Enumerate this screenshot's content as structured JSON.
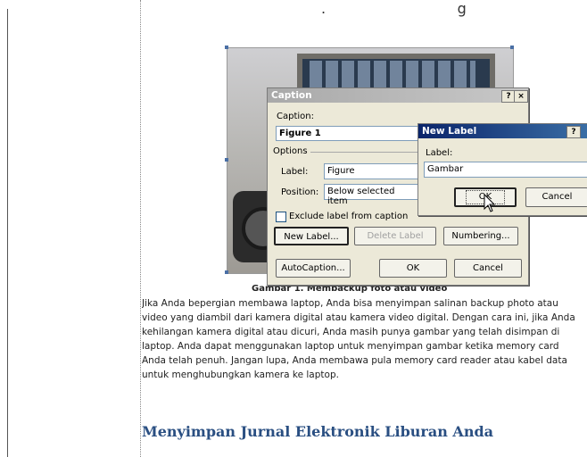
{
  "document": {
    "figure_caption": "Gambar 1. Membackup foto atau video",
    "paragraph_lines": [
      "Jika Anda bepergian membawa laptop, Anda bisa menyimpan salinan backup photo atau",
      "video yang diambil dari kamera digital atau kamera video digital. Dengan cara ini, jika Anda",
      "kehilangan kamera digital atau dicuri, Anda masih punya gambar yang telah disimpan di",
      "laptop. Anda dapat menggunakan laptop untuk menyimpan gambar ketika memory card",
      "Anda telah penuh. Jangan lupa, Anda membawa pula memory card reader atau kabel data",
      "untuk menghubungkan kamera ke laptop."
    ],
    "heading": "Menyimpan Jurnal Elektronik Liburan Anda"
  },
  "caption_dialog": {
    "title": "Caption",
    "help_btn": "?",
    "close_btn": "×",
    "caption_label": "Caption:",
    "caption_value": "Figure 1",
    "options_label": "Options",
    "label_label": "Label:",
    "label_value": "Figure",
    "position_label": "Position:",
    "position_value": "Below selected item",
    "exclude_label": "Exclude label from caption",
    "new_label_btn": "New Label...",
    "delete_label_btn": "Delete Label",
    "numbering_btn": "Numbering...",
    "autocaption_btn": "AutoCaption...",
    "ok_btn": "OK",
    "cancel_btn": "Cancel"
  },
  "new_label_dialog": {
    "title": "New Label",
    "help_btn": "?",
    "label_label": "Label:",
    "label_value": "Gambar",
    "ok_btn": "OK",
    "cancel_btn": "Cancel"
  }
}
